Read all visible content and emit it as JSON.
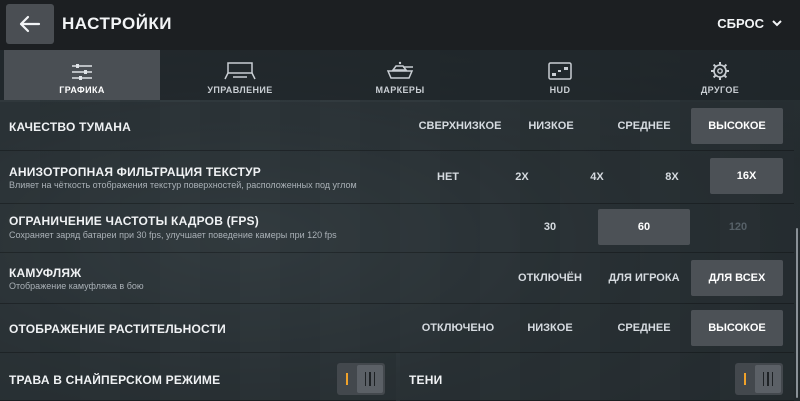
{
  "header": {
    "title": "НАСТРОЙКИ",
    "reset_label": "СБРОС"
  },
  "tabs": [
    {
      "label": "ГРАФИКА",
      "icon": "sliders-icon",
      "active": true
    },
    {
      "label": "УПРАВЛЕНИЕ",
      "icon": "controls-icon",
      "active": false
    },
    {
      "label": "МАРКЕРЫ",
      "icon": "tank-marker-icon",
      "active": false
    },
    {
      "label": "HUD",
      "icon": "hud-icon",
      "active": false
    },
    {
      "label": "ДРУГОЕ",
      "icon": "gear-icon",
      "active": false
    }
  ],
  "settings": {
    "fog": {
      "title": "КАЧЕСТВО ТУМАНА",
      "options": [
        "СВЕРХНИЗКОЕ",
        "НИЗКОЕ",
        "СРЕДНЕЕ",
        "ВЫСОКОЕ"
      ],
      "selected": "ВЫСОКОЕ"
    },
    "aniso": {
      "title": "АНИЗОТРОПНАЯ ФИЛЬТРАЦИЯ ТЕКСТУР",
      "desc": "Влияет на чёткость отображения текстур поверхностей, расположенных под углом",
      "options": [
        "НЕТ",
        "2X",
        "4X",
        "8X",
        "16X"
      ],
      "selected": "16X"
    },
    "fps": {
      "title": "ОГРАНИЧЕНИЕ ЧАСТОТЫ КАДРОВ (FPS)",
      "desc": "Сохраняет заряд батареи при 30 fps, улучшает поведение камеры при 120 fps",
      "options": [
        "30",
        "60",
        "120"
      ],
      "selected": "60",
      "disabled": [
        "120"
      ]
    },
    "camo": {
      "title": "КАМУФЛЯЖ",
      "desc": "Отображение камуфляжа в бою",
      "options": [
        "ОТКЛЮЧЁН",
        "ДЛЯ ИГРОКА",
        "ДЛЯ ВСЕХ"
      ],
      "selected": "ДЛЯ ВСЕХ"
    },
    "vegetation": {
      "title": "ОТОБРАЖЕНИЕ РАСТИТЕЛЬНОСТИ",
      "options": [
        "ОТКЛЮЧЕНО",
        "НИЗКОЕ",
        "СРЕДНЕЕ",
        "ВЫСОКОЕ"
      ],
      "selected": "ВЫСОКОЕ"
    },
    "sniper_grass": {
      "title": "ТРАВА В СНАЙПЕРСКОМ РЕЖИМЕ",
      "enabled": true
    },
    "shadows": {
      "title": "ТЕНИ",
      "enabled": true
    }
  },
  "colors": {
    "accent": "#f0a22a",
    "selected_bg": "#4c5156",
    "header_bg": "#1c1f22"
  }
}
